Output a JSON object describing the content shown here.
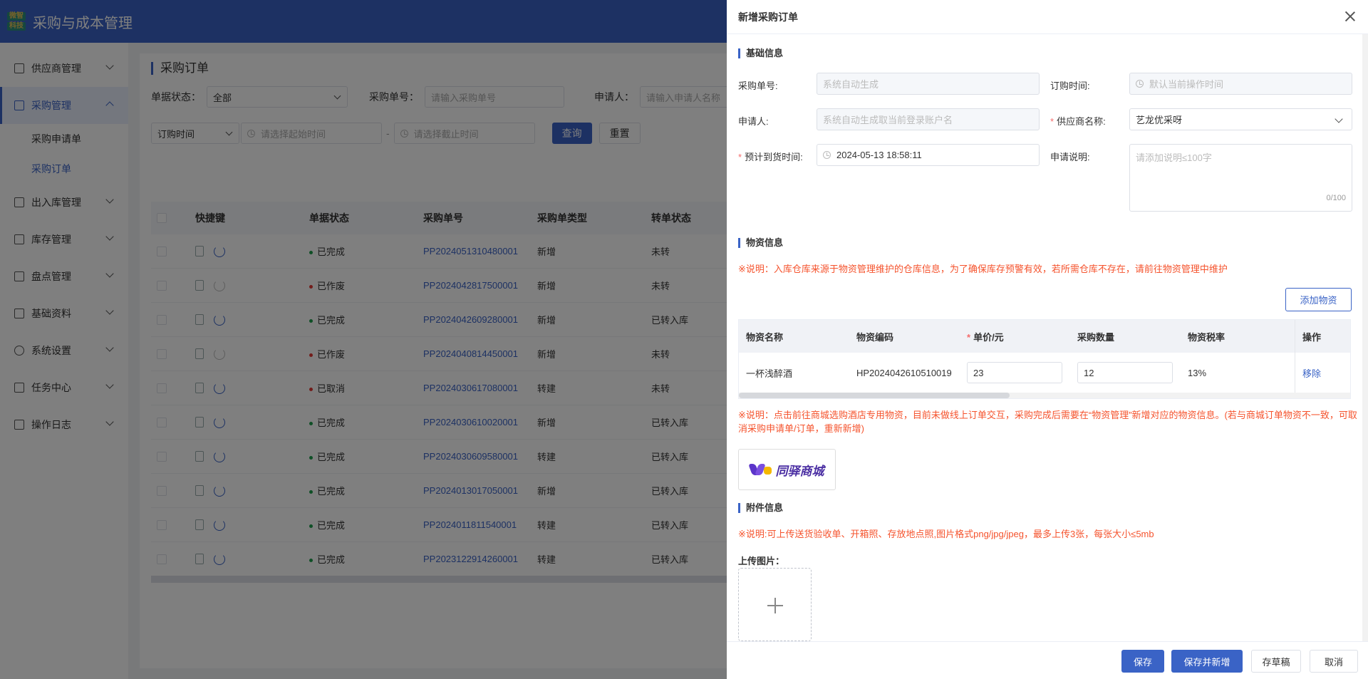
{
  "header": {
    "logo_top": "微智",
    "logo_bottom": "科技",
    "app_title": "采购与成本管理"
  },
  "sidebar": {
    "items": [
      {
        "label": "供应商管理",
        "icon": "supplier-icon"
      },
      {
        "label": "采购管理",
        "icon": "cart-icon"
      },
      {
        "label": "出入库管理",
        "icon": "inout-icon"
      },
      {
        "label": "库存管理",
        "icon": "inventory-icon"
      },
      {
        "label": "盘点管理",
        "icon": "stocktake-icon"
      },
      {
        "label": "基础资料",
        "icon": "basic-data-icon"
      },
      {
        "label": "系统设置",
        "icon": "settings-icon"
      },
      {
        "label": "任务中心",
        "icon": "task-icon"
      },
      {
        "label": "操作日志",
        "icon": "log-icon"
      }
    ],
    "sub_items": [
      {
        "label": "采购申请单"
      },
      {
        "label": "采购订单"
      }
    ]
  },
  "main": {
    "title": "采购订单",
    "filters": {
      "status_label": "单据状态：",
      "status_value": "全部",
      "order_no_label": "采购单号：",
      "order_no_placeholder": "请输入采购单号",
      "applicant_label": "申请人：",
      "applicant_placeholder": "请输入申请人名称",
      "time_type": "订购时间",
      "start_placeholder": "请选择起始时间",
      "dash": "-",
      "end_placeholder": "请选择截止时间",
      "query": "查询",
      "reset": "重置"
    },
    "table": {
      "headers": {
        "quick": "快捷键",
        "status": "单据状态",
        "no": "采购单号",
        "type": "采购单类型",
        "conv": "转单状态"
      },
      "rows": [
        {
          "status": "已完成",
          "status_color": "#1f9e4d",
          "no": "PP2024051310480001",
          "type": "新增",
          "conv": "未转",
          "active": true
        },
        {
          "status": "已作废",
          "status_color": "#e53935",
          "no": "PP2024042817500001",
          "type": "新增",
          "conv": "未转",
          "active": false
        },
        {
          "status": "已完成",
          "status_color": "#1f9e4d",
          "no": "PP2024042609280001",
          "type": "新增",
          "conv": "已转入库",
          "active": true
        },
        {
          "status": "已作废",
          "status_color": "#e53935",
          "no": "PP2024040814450001",
          "type": "新增",
          "conv": "未转",
          "active": false
        },
        {
          "status": "已取消",
          "status_color": "#e53935",
          "no": "PP2024030617080001",
          "type": "转建",
          "conv": "未转",
          "active": true
        },
        {
          "status": "已完成",
          "status_color": "#1f9e4d",
          "no": "PP2024030610020001",
          "type": "新增",
          "conv": "已转入库",
          "active": true
        },
        {
          "status": "已完成",
          "status_color": "#1f9e4d",
          "no": "PP2024030609580001",
          "type": "转建",
          "conv": "已转入库",
          "active": true
        },
        {
          "status": "已完成",
          "status_color": "#1f9e4d",
          "no": "PP2024013017050001",
          "type": "新增",
          "conv": "已转入库",
          "active": true
        },
        {
          "status": "已完成",
          "status_color": "#1f9e4d",
          "no": "PP2024011811540001",
          "type": "转建",
          "conv": "已转入库",
          "active": true
        },
        {
          "status": "已完成",
          "status_color": "#1f9e4d",
          "no": "PP2023122914260001",
          "type": "转建",
          "conv": "已转入库",
          "active": true
        }
      ]
    }
  },
  "drawer": {
    "title": "新增采购订单",
    "basic": {
      "title": "基础信息",
      "order_no_label": "采购单号:",
      "order_no_placeholder": "系统自动生成",
      "order_time_label": "订购时间:",
      "order_time_placeholder": "默认当前操作时间",
      "applicant_label": "申请人:",
      "applicant_placeholder": "系统自动生成取当前登录账户名",
      "supplier_label": "供应商名称:",
      "supplier_value": "艺龙优采呀",
      "arrival_label": "预计到货时间:",
      "arrival_value": "2024-05-13 18:58:11",
      "remark_label": "申请说明:",
      "remark_placeholder": "请添加说明≤100字",
      "remark_counter": "0/100"
    },
    "material": {
      "title": "物资信息",
      "note1": "※说明：入库仓库来源于物资管理维护的仓库信息，为了确保库存预警有效，若所需仓库不存在，请前往物资管理中维护",
      "add_button": "添加物资",
      "headers": {
        "name": "物资名称",
        "code": "物资编码",
        "price": "单价/元",
        "qty": "采购数量",
        "tax": "物资税率",
        "op": "操作"
      },
      "row": {
        "name": "一杯浅醉酒",
        "code": "HP2024042610510019",
        "price": "23",
        "qty": "12",
        "tax": "13%",
        "remove": "移除"
      },
      "note2": "※说明：点击前往商城选购酒店专用物资，目前未做线上订单交互，采购完成后需要在“物资管理”新增对应的物资信息。(若与商城订单物资不一致，可取消采购申请单/订单，重新新增)",
      "mall_name": "同驿商城"
    },
    "attach": {
      "title": "附件信息",
      "note": "※说明:可上传送货验收单、开箱照、存放地点照,图片格式png/jpg/jpeg，最多上传3张，每张大小≤5mb",
      "upload_label": "上传图片："
    },
    "footer": {
      "save": "保存",
      "save_new": "保存并新增",
      "draft": "存草稿",
      "cancel": "取消"
    }
  }
}
